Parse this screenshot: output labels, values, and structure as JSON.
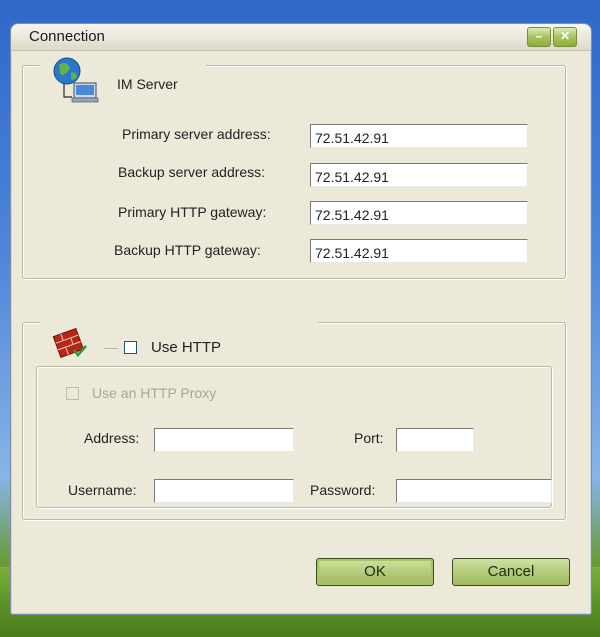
{
  "window": {
    "title": "Connection"
  },
  "im_server": {
    "legend": "IM Server",
    "fields": [
      {
        "label": "Primary server address:",
        "value": "72.51.42.91"
      },
      {
        "label": "Backup server address:",
        "value": "72.51.42.91"
      },
      {
        "label": "Primary HTTP gateway:",
        "value": "72.51.42.91"
      },
      {
        "label": "Backup HTTP gateway:",
        "value": "72.51.42.91"
      }
    ]
  },
  "http": {
    "use_http_label": "Use HTTP",
    "use_http_checked": false,
    "proxy": {
      "use_proxy_label": "Use an HTTP Proxy",
      "use_proxy_checked": false,
      "enabled": false,
      "address_label": "Address:",
      "address_value": "",
      "port_label": "Port:",
      "port_value": "",
      "username_label": "Username:",
      "username_value": "",
      "password_label": "Password:",
      "password_value": ""
    }
  },
  "buttons": {
    "ok": "OK",
    "cancel": "Cancel"
  },
  "icons": {
    "server": "network-globe-icon",
    "http": "firewall-bricks-icon",
    "minimize": "minimize-icon",
    "close": "close-icon"
  }
}
